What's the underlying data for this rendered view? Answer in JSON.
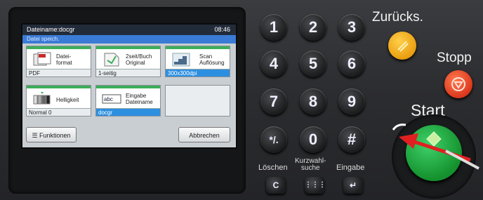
{
  "screen": {
    "title_left": "Dateiname:docgr",
    "title_right": "08:46",
    "subtitle": "Datei speich.",
    "tiles": [
      {
        "label": "Datei-\nformat",
        "value": "PDF",
        "selected": false
      },
      {
        "label": "2seit/Buch\nOriginal",
        "value": "1-seitig",
        "selected": false
      },
      {
        "label": "Scan\nAuflösung",
        "value": "300x300dpi",
        "selected": true
      },
      {
        "label": "Helligkeit",
        "value": "Normal 0",
        "selected": false
      },
      {
        "label": "Eingabe\nDateiname",
        "value": "docgr",
        "selected": true
      }
    ],
    "functions_label": "Funktionen",
    "cancel_label": "Abbrechen"
  },
  "keypad": {
    "keys": [
      "1",
      "2",
      "3",
      "4",
      "5",
      "6",
      "7",
      "8",
      "9",
      "*/.",
      "0",
      "#"
    ],
    "clear_label": "Löschen",
    "speed_label": "Kurzwahl-\nsuche",
    "enter_label": "Eingabe",
    "clear_key": "C",
    "speed_key": "⋮⋮⋮",
    "enter_key": "↵"
  },
  "controls": {
    "reset_label": "Zurücks.",
    "stop_label": "Stopp",
    "start_label": "Start"
  },
  "colors": {
    "accent_green": "#3cae5a",
    "select_blue": "#2d8fe0",
    "reset": "#f0a41a",
    "stop": "#e0391f",
    "start": "#1fae45"
  }
}
